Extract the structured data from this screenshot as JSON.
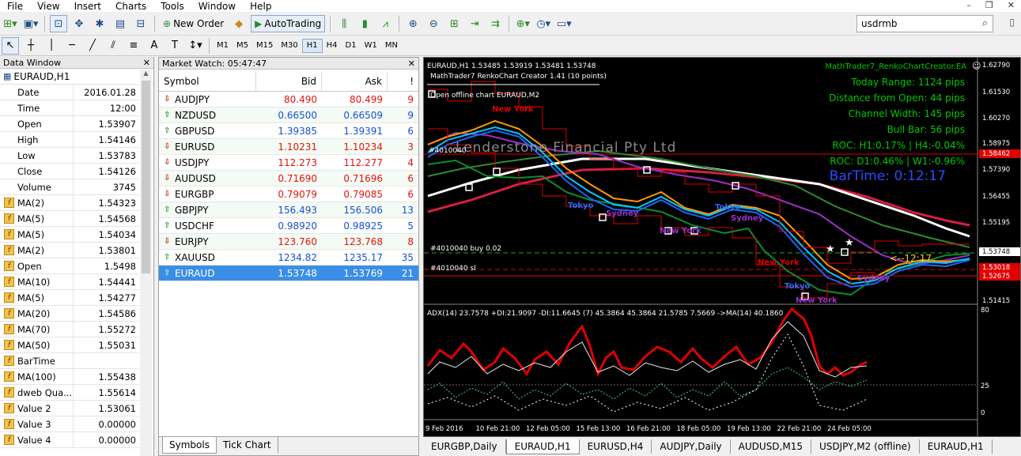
{
  "menu": [
    "File",
    "View",
    "Insert",
    "Charts",
    "Tools",
    "Window",
    "Help"
  ],
  "toolbar": {
    "new_order": "New Order",
    "autotrading": "AutoTrading",
    "search_value": "usdrmb",
    "timeframes": [
      "M1",
      "M5",
      "M15",
      "M30",
      "H1",
      "H4",
      "D1",
      "W1",
      "MN"
    ],
    "active_timeframe": "H1"
  },
  "data_window": {
    "title": "Data Window",
    "symbol": "EURAUD,H1",
    "rows": [
      {
        "k": "Date",
        "v": "2016.01.28",
        "fx": false
      },
      {
        "k": "Time",
        "v": "12:00",
        "fx": false
      },
      {
        "k": "Open",
        "v": "1.53907",
        "fx": false
      },
      {
        "k": "High",
        "v": "1.54146",
        "fx": false
      },
      {
        "k": "Low",
        "v": "1.53783",
        "fx": false
      },
      {
        "k": "Close",
        "v": "1.54126",
        "fx": false
      },
      {
        "k": "Volume",
        "v": "3745",
        "fx": false
      },
      {
        "k": "MA(2)",
        "v": "1.54323",
        "fx": true
      },
      {
        "k": "MA(5)",
        "v": "1.54568",
        "fx": true
      },
      {
        "k": "MA(5)",
        "v": "1.54034",
        "fx": true
      },
      {
        "k": "MA(2)",
        "v": "1.53801",
        "fx": true
      },
      {
        "k": "Open",
        "v": "1.5498",
        "fx": true
      },
      {
        "k": "MA(10)",
        "v": "1.54441",
        "fx": true
      },
      {
        "k": "MA(5)",
        "v": "1.54277",
        "fx": true
      },
      {
        "k": "MA(20)",
        "v": "1.54586",
        "fx": true
      },
      {
        "k": "MA(70)",
        "v": "1.55272",
        "fx": true
      },
      {
        "k": "MA(50)",
        "v": "1.55031",
        "fx": true
      },
      {
        "k": "BarTime",
        "v": "",
        "fx": true
      },
      {
        "k": "MA(100)",
        "v": "1.55438",
        "fx": true
      },
      {
        "k": "dweb Qua...",
        "v": "1.55614",
        "fx": true
      },
      {
        "k": "Value 2",
        "v": "1.53061",
        "fx": true
      },
      {
        "k": "Value 3",
        "v": "0.00000",
        "fx": true
      },
      {
        "k": "Value 4",
        "v": "0.00000",
        "fx": true
      }
    ]
  },
  "market_watch": {
    "title": "Market Watch: 05:47:47",
    "headers": {
      "symbol": "Symbol",
      "bid": "Bid",
      "ask": "Ask",
      "spread": "!"
    },
    "rows": [
      {
        "s": "AUDJPY",
        "bid": "80.490",
        "ask": "80.499",
        "sp": "9",
        "dir": "down"
      },
      {
        "s": "NZDUSD",
        "bid": "0.66500",
        "ask": "0.66509",
        "sp": "9",
        "dir": "up"
      },
      {
        "s": "GBPUSD",
        "bid": "1.39385",
        "ask": "1.39391",
        "sp": "6",
        "dir": "up"
      },
      {
        "s": "EURUSD",
        "bid": "1.10231",
        "ask": "1.10234",
        "sp": "3",
        "dir": "down"
      },
      {
        "s": "USDJPY",
        "bid": "112.273",
        "ask": "112.277",
        "sp": "4",
        "dir": "down"
      },
      {
        "s": "AUDUSD",
        "bid": "0.71690",
        "ask": "0.71696",
        "sp": "6",
        "dir": "down"
      },
      {
        "s": "EURGBP",
        "bid": "0.79079",
        "ask": "0.79085",
        "sp": "6",
        "dir": "down"
      },
      {
        "s": "GBPJPY",
        "bid": "156.493",
        "ask": "156.506",
        "sp": "13",
        "dir": "up"
      },
      {
        "s": "USDCHF",
        "bid": "0.98920",
        "ask": "0.98925",
        "sp": "5",
        "dir": "up"
      },
      {
        "s": "EURJPY",
        "bid": "123.760",
        "ask": "123.768",
        "sp": "8",
        "dir": "down"
      },
      {
        "s": "XAUUSD",
        "bid": "1234.82",
        "ask": "1235.17",
        "sp": "35",
        "dir": "up"
      },
      {
        "s": "EURAUD",
        "bid": "1.53748",
        "ask": "1.53769",
        "sp": "21",
        "dir": "up",
        "selected": true
      }
    ],
    "tabs": [
      "Symbols",
      "Tick Chart"
    ]
  },
  "chart": {
    "header": "EURAUD,H1  1.53485 1.53919 1.53481 1.53748",
    "subheader": "MathTrader7 RenkoChart Creator 1.41 (10 points)",
    "offline_label": "Open offline chart EURAUD,M2",
    "order_label_1": "#4010040 buy 0.02",
    "order_label_2": "#4010040 sl",
    "order_label_3": "#4010040",
    "watermark": "Lenderstone Financial Pty Ltd",
    "ea_name": "MathTrader7_RenkoChartCreator.EA",
    "stats": [
      "Today Range:  1124 pips",
      "Distance from Open:  44 pips",
      "Channel Width: 145 pips",
      "Bull Bar: 56 pips",
      "ROC: H1:0.17% | H4:-0.04%",
      "ROC: D1:0.46% | W1:-0.96%"
    ],
    "bartime": "BarTime:   0:12:17",
    "countdown": "<--12:17",
    "session_labels": [
      "New York",
      "Tokyo",
      "Sydney",
      "New York",
      "Tokyo",
      "Sydney",
      "New York",
      "Tokyo",
      "Sydney",
      "New York"
    ],
    "price_axis": [
      "1.62790",
      "1.61530",
      "1.60270",
      "1.58975",
      "1.58462",
      "1.57390",
      "1.56455",
      "1.55195",
      "1.53748",
      "1.53018",
      "1.52675",
      "1.51415"
    ],
    "adx_header": "ADX(14) 23.7578 +DI:21.9097 -DI:11.6645  (7)  45.3864 45.3864 21.5785 7.5669  ->MA(14) 40.1860",
    "adx_axis": [
      "80",
      "25",
      "0"
    ],
    "time_axis": [
      "9 Feb 2016",
      "10 Feb 21:00",
      "12 Feb 05:00",
      "15 Feb 13:00",
      "16 Feb 21:00",
      "18 Feb 05:00",
      "19 Feb 13:00",
      "22 Feb 21:00",
      "24 Feb 05:00"
    ]
  },
  "chart_tabs": [
    "EURGBP,Daily",
    "EURAUD,H1",
    "EURUSD,H4",
    "AUDJPY,Daily",
    "AUDUSD,M15",
    "USDJPY,M2 (offline)",
    "EURAUD,H1"
  ],
  "active_chart_tab": 1
}
